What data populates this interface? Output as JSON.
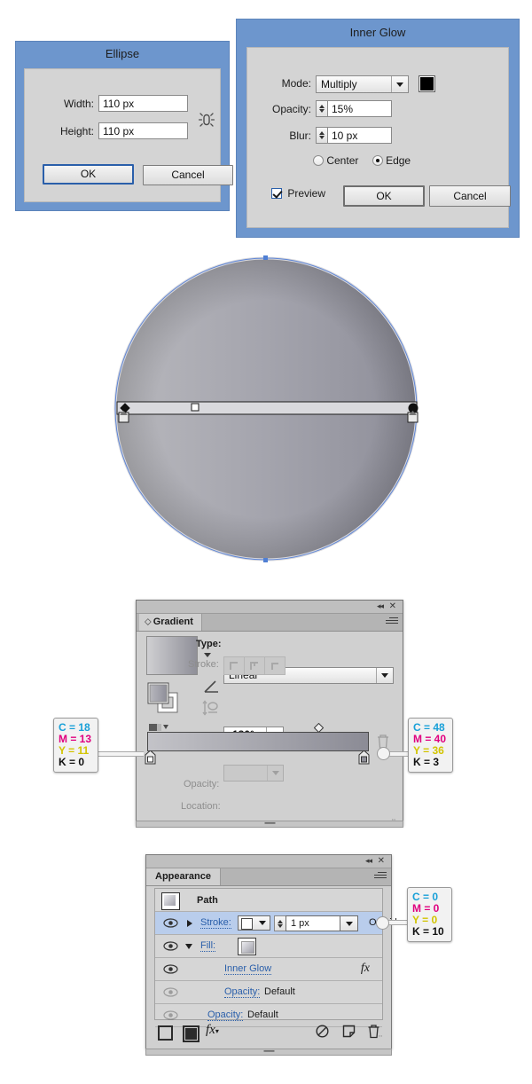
{
  "ellipse_dialog": {
    "title": "Ellipse",
    "width_label": "Width:",
    "width_value": "110 px",
    "height_label": "Height:",
    "height_value": "110 px",
    "ok_label": "OK",
    "cancel_label": "Cancel",
    "constrain_icon": "constrain-proportions-icon"
  },
  "inner_glow_dialog": {
    "title": "Inner Glow",
    "mode_label": "Mode:",
    "mode_value": "Multiply",
    "mode_options": [
      "Multiply"
    ],
    "color_swatch": "#000000",
    "opacity_label": "Opacity:",
    "opacity_value": "15%",
    "blur_label": "Blur:",
    "blur_value": "10 px",
    "radio_center": "Center",
    "radio_edge": "Edge",
    "radio_selected": "Edge",
    "preview_label": "Preview",
    "preview_checked": true,
    "ok_label": "OK",
    "cancel_label": "Cancel"
  },
  "artboard": {
    "shape": "gradient-filled-circle",
    "gradient_start": "#b5b5bb",
    "gradient_end": "#8e8e98",
    "selection_color": "#4f7fd4"
  },
  "gradient_panel": {
    "tab_label": "Gradient",
    "type_label": "Type:",
    "type_value": "Linear",
    "stroke_label": "Stroke:",
    "angle_value": "-180°",
    "opacity_label": "Opacity:",
    "opacity_value": "",
    "location_label": "Location:",
    "location_value": "",
    "stop_left": {
      "c": "C = 18",
      "m": "M = 13",
      "y": "Y = 11",
      "k": "K = 0"
    },
    "stop_right": {
      "c": "C = 48",
      "m": "M = 40",
      "y": "Y = 36",
      "k": "K = 3"
    }
  },
  "appearance_panel": {
    "tab_label": "Appearance",
    "path_label": "Path",
    "stroke_label": "Stroke:",
    "stroke_weight": "1 px",
    "stroke_align": "Outside",
    "fill_label": "Fill:",
    "inner_glow_label": "Inner Glow",
    "fx_label": "fx",
    "opacity_label_1": "Opacity:",
    "opacity_value_1": "Default",
    "opacity_label_2": "Opacity:",
    "opacity_value_2": "Default",
    "stroke_color": {
      "c": "C = 0",
      "m": "M = 0",
      "y": "Y = 0",
      "k": "K = 10"
    }
  }
}
